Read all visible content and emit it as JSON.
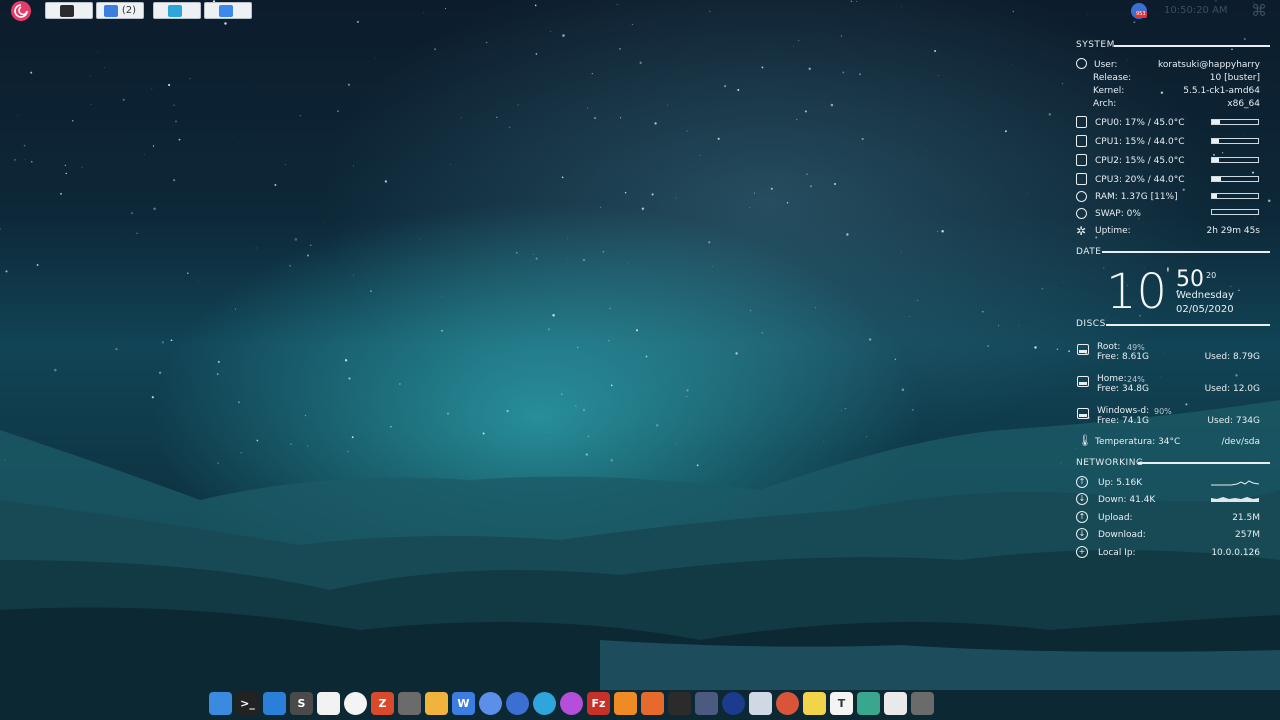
{
  "topbar": {
    "tasks": [
      {
        "name": "terminal-task",
        "label": "",
        "icon": "terminal-icon",
        "color": "#2b2b2b"
      },
      {
        "name": "wps-task",
        "label": "(2)",
        "icon": "wps-icon",
        "color": "#3d7de0"
      },
      {
        "name": "telegram-task",
        "label": "",
        "icon": "telegram-icon",
        "color": "#2ea6db"
      },
      {
        "name": "finder-task",
        "label": "",
        "icon": "finder-icon",
        "color": "#3b89e8"
      }
    ],
    "tray_badge": "953",
    "clock": "10:50:20 AM",
    "command_glyph": "⌘"
  },
  "conky": {
    "system": {
      "title": "SYSTEM",
      "user_label": "User:",
      "user": "koratsuki@happyharry",
      "release_label": "Release:",
      "release": "10 [buster]",
      "kernel_label": "Kernel:",
      "kernel": "5.5.1-ck1-amd64",
      "arch_label": "Arch:",
      "arch": "x86_64",
      "cpus": [
        {
          "label": "CPU0: 17% / 45.0°C",
          "usage": 0.17
        },
        {
          "label": "CPU1: 15% / 44.0°C",
          "usage": 0.15
        },
        {
          "label": "CPU2: 15% / 45.0°C",
          "usage": 0.15
        },
        {
          "label": "CPU3: 20% / 44.0°C",
          "usage": 0.2
        }
      ],
      "ram": {
        "label": "RAM: 1.37G [11%]",
        "usage": 0.11
      },
      "swap": {
        "label": "SWAP: 0%",
        "usage": 0.0
      },
      "uptime_label": "Uptime:",
      "uptime": "2h 29m 45s"
    },
    "date": {
      "title": "DATE",
      "hour": "10",
      "minute": "50",
      "second": "20",
      "weekday": "Wednesday",
      "date": "02/05/2020"
    },
    "discs": {
      "title": "DISCS",
      "items": [
        {
          "name": "Root:",
          "pct": "49%",
          "free": "Free: 8.61G",
          "used": "Used: 8.79G"
        },
        {
          "name": "Home:",
          "pct": "24%",
          "free": "Free: 34.8G",
          "used": "Used: 12.0G"
        },
        {
          "name": "Windows-d:",
          "pct": "90%",
          "free": "Free: 74.1G",
          "used": "Used: 734G"
        }
      ],
      "temp": "Temperatura: 34°C",
      "device": "/dev/sda"
    },
    "networking": {
      "title": "NETWORKING",
      "up": "Up: 5.16K",
      "down": "Down: 41.4K",
      "upload_label": "Upload:",
      "upload": "21.5M",
      "download_label": "Download:",
      "download": "257M",
      "ip_label": "Local Ip:",
      "ip": "10.0.0.126"
    }
  },
  "dock": {
    "apps": [
      {
        "name": "file-manager-icon",
        "color": "#3a8be0",
        "glyph": ""
      },
      {
        "name": "terminal-icon",
        "color": "#222",
        "glyph": ">_"
      },
      {
        "name": "finder-icon",
        "color": "#2a7fd9",
        "glyph": ""
      },
      {
        "name": "sublime-text-icon",
        "color": "#4a4a4a",
        "glyph": "S"
      },
      {
        "name": "text-editor-icon",
        "color": "#f2f2f2",
        "glyph": ""
      },
      {
        "name": "cloud-sync-icon",
        "color": "#f4f4f4",
        "glyph": ""
      },
      {
        "name": "filezilla-z-icon",
        "color": "#d9492c",
        "glyph": "Z"
      },
      {
        "name": "calculator-icon",
        "color": "#6b6b6b",
        "glyph": ""
      },
      {
        "name": "folder-icon",
        "color": "#f0b43c",
        "glyph": ""
      },
      {
        "name": "wps-office-icon",
        "color": "#3d7de0",
        "glyph": "W"
      },
      {
        "name": "chromium-icon",
        "color": "#5b8fe8",
        "glyph": ""
      },
      {
        "name": "mail-badge-icon",
        "color": "#3b6fd1",
        "glyph": ""
      },
      {
        "name": "telegram-icon",
        "color": "#2ea6db",
        "glyph": ""
      },
      {
        "name": "messenger-icon",
        "color": "#b34fd9",
        "glyph": ""
      },
      {
        "name": "filezilla-icon",
        "color": "#c8302a",
        "glyph": "Fz"
      },
      {
        "name": "network-icon",
        "color": "#f08a24",
        "glyph": ""
      },
      {
        "name": "sublime-merge-icon",
        "color": "#e56a2c",
        "glyph": ""
      },
      {
        "name": "inkscape-icon",
        "color": "#2b2b2b",
        "glyph": ""
      },
      {
        "name": "video-call-icon",
        "color": "#4a5a80",
        "glyph": ""
      },
      {
        "name": "playstation-icon",
        "color": "#1b3c8c",
        "glyph": ""
      },
      {
        "name": "game-controller-icon",
        "color": "#cfd9e6",
        "glyph": ""
      },
      {
        "name": "disk-burner-icon",
        "color": "#d8553a",
        "glyph": ""
      },
      {
        "name": "sticky-notes-icon",
        "color": "#f1d44a",
        "glyph": ""
      },
      {
        "name": "typora-icon",
        "color": "#f4f4f4",
        "glyph": "T"
      },
      {
        "name": "image-viewer-icon",
        "color": "#3aa68e",
        "glyph": ""
      },
      {
        "name": "downloads-icon",
        "color": "#e9e9e9",
        "glyph": ""
      },
      {
        "name": "settings-icon",
        "color": "#6b6b6b",
        "glyph": ""
      }
    ]
  }
}
